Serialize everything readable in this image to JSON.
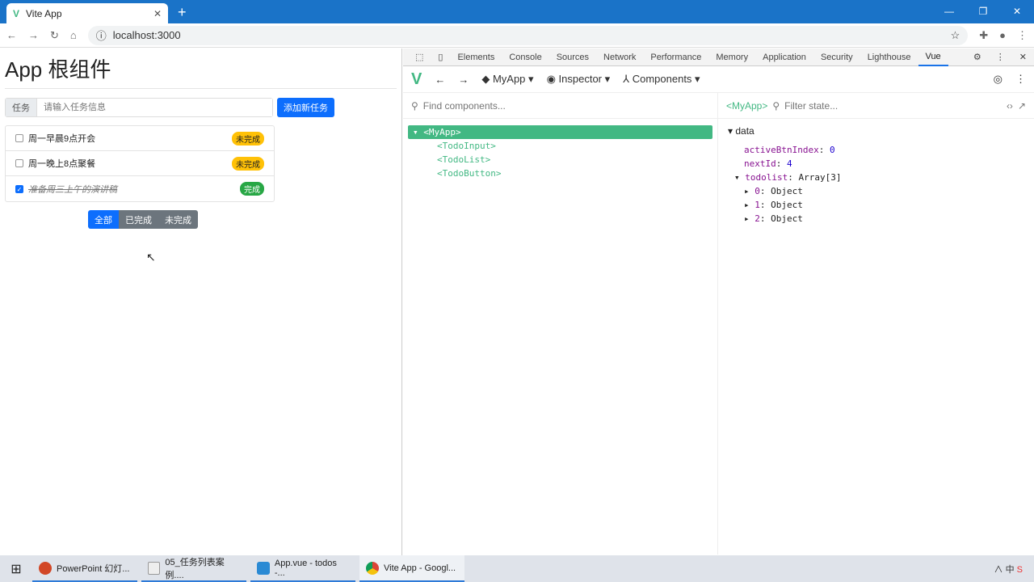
{
  "browser": {
    "tab_title": "Vite App",
    "url": "localhost:3000"
  },
  "app": {
    "title": "App 根组件",
    "input_label": "任务",
    "input_placeholder": "请输入任务信息",
    "add_button": "添加新任务",
    "todos": [
      {
        "text": "周一早晨9点开会",
        "done": false,
        "status": "未完成"
      },
      {
        "text": "周一晚上8点聚餐",
        "done": false,
        "status": "未完成"
      },
      {
        "text": "准备周三上午的演讲稿",
        "done": true,
        "status": "完成"
      }
    ],
    "filters": [
      "全部",
      "已完成",
      "未完成"
    ]
  },
  "devtools": {
    "tabs": [
      "Elements",
      "Console",
      "Sources",
      "Network",
      "Performance",
      "Memory",
      "Application",
      "Security",
      "Lighthouse",
      "Vue"
    ],
    "vue": {
      "app": "MyApp",
      "mode": "Inspector",
      "view": "Components",
      "find_placeholder": "Find components...",
      "selected": "<MyApp>",
      "filter_placeholder": "Filter state...",
      "tree": [
        "<MyApp>",
        "<TodoInput>",
        "<TodoList>",
        "<TodoButton>"
      ],
      "section": "data",
      "state": [
        {
          "k": "activeBtnIndex",
          "v": "0"
        },
        {
          "k": "nextId",
          "v": "4"
        },
        {
          "k": "todolist",
          "v": "Array[3]"
        }
      ],
      "items": [
        {
          "k": "0",
          "v": "Object"
        },
        {
          "k": "1",
          "v": "Object"
        },
        {
          "k": "2",
          "v": "Object"
        }
      ]
    }
  },
  "taskbar": [
    "PowerPoint 幻灯...",
    "05_任务列表案例....",
    "App.vue - todos -...",
    "Vite App - Googl..."
  ]
}
